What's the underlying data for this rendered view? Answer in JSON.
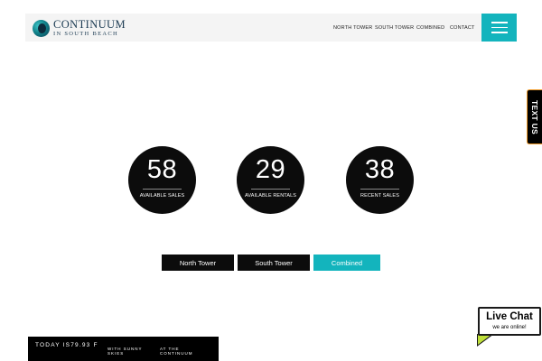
{
  "header": {
    "logo_title": "CONTINUUM",
    "logo_sub": "IN SOUTH BEACH",
    "nav": [
      {
        "label": "NORTH TOWER"
      },
      {
        "label": "SOUTH TOWER"
      },
      {
        "label": "COMBINED"
      },
      {
        "label": "CONTACT"
      }
    ],
    "menu_icon": "hamburger-icon"
  },
  "stats": [
    {
      "value": "58",
      "label": "AVAILABLE SALES"
    },
    {
      "value": "29",
      "label": "AVAILABLE RENTALS"
    },
    {
      "value": "38",
      "label": "RECENT SALES"
    }
  ],
  "tabs": [
    {
      "label": "North Tower",
      "active": false
    },
    {
      "label": "South Tower",
      "active": false
    },
    {
      "label": "Combined",
      "active": true
    }
  ],
  "weather": {
    "today": "TODAY IS79.93 F",
    "condition": "WITH SUNNY SKIES",
    "location": "AT THE CONTINUUM"
  },
  "text_us": {
    "label": "TEXT US"
  },
  "live_chat": {
    "title": "Live Chat",
    "subtitle": "we are online!"
  },
  "colors": {
    "accent": "#13b4bd",
    "dark": "#0c0c0c",
    "text_us_border": "#f29b27",
    "chat_tail": "#bfe03a"
  }
}
